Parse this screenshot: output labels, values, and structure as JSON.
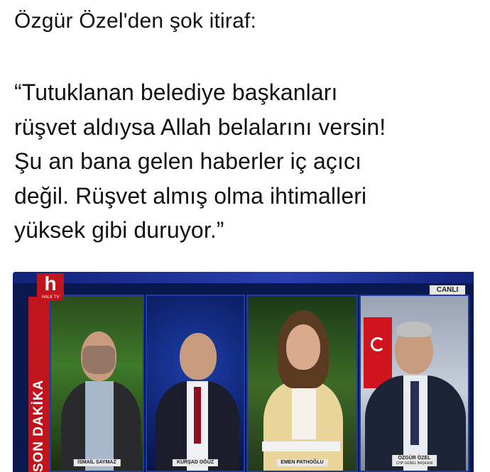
{
  "headline": "Özgür Özel'den şok itiraf:",
  "quote_lines": [
    "“Tutuklanan belediye başkanları",
    "rüşvet aldıysa Allah belalarını versin!",
    "Şu an bana gelen haberler iç açıcı",
    "değil. Rüşvet almış olma ihtimalleri",
    "yüksek gibi duruyor.”"
  ],
  "tv": {
    "logo_letter": "h",
    "logo_sub": "HALK TV",
    "live_badge": "CANLI",
    "side_banner": "SON DAKİKA",
    "panels": [
      {
        "name": "İSMAİL SAYMAZ",
        "title": ""
      },
      {
        "name": "KÜRŞAD OĞUZ",
        "title": ""
      },
      {
        "name": "EMEN PATHOĞLU",
        "title": ""
      },
      {
        "name": "ÖZGÜR ÖZEL",
        "title": "CHP GENEL BAŞKANI"
      }
    ]
  },
  "colors": {
    "brand_red": "#c0151c",
    "tv_blue": "#1d3aa8"
  }
}
